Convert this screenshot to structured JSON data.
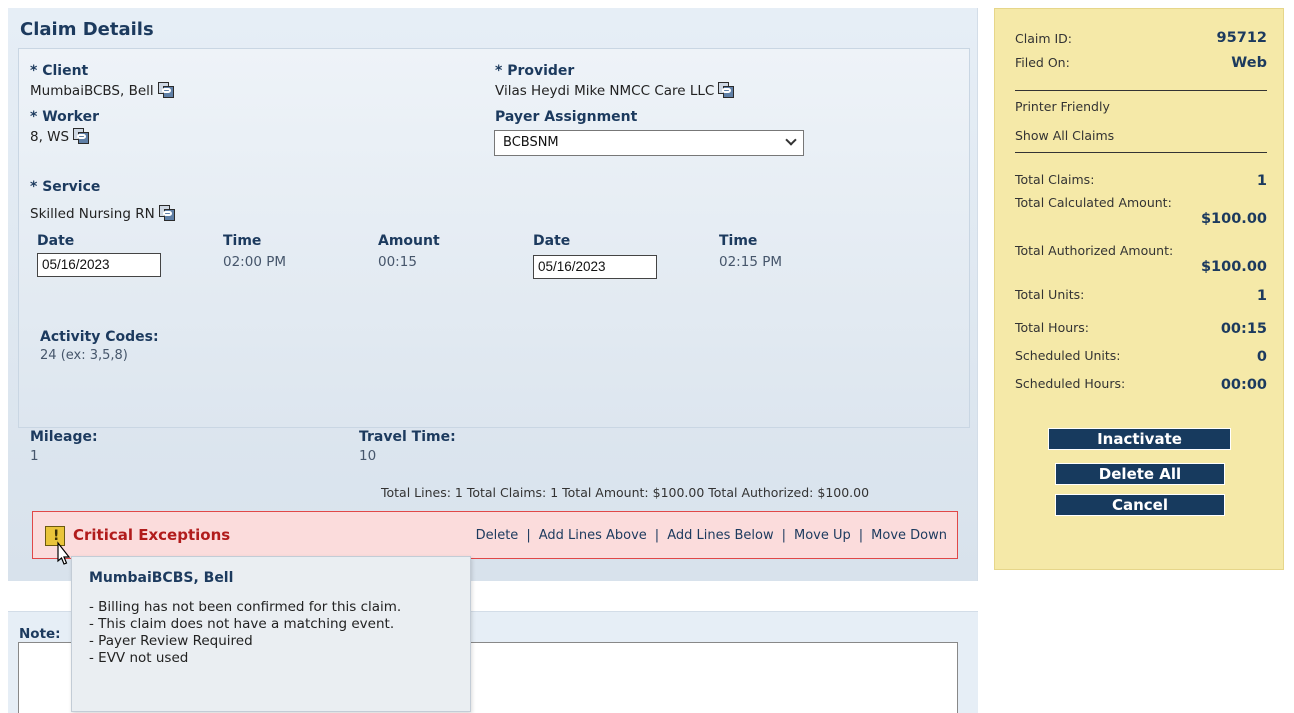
{
  "title": "Claim Details",
  "client": {
    "label": "* Client",
    "value": "MumbaiBCBS, Bell"
  },
  "provider": {
    "label": "* Provider",
    "value": "Vilas Heydi Mike NMCC Care LLC"
  },
  "worker": {
    "label": "* Worker",
    "value": "8, WS"
  },
  "payer": {
    "label": "Payer Assignment",
    "value": "BCBSNM"
  },
  "service": {
    "label": "* Service",
    "value": "Skilled Nursing RN"
  },
  "visit": {
    "start_date_label": "Date",
    "start_date": "05/16/2023",
    "start_time_label": "Time",
    "start_time": "02:00 PM",
    "amount_label": "Amount",
    "amount": "00:15",
    "end_date_label": "Date",
    "end_date": "05/16/2023",
    "end_time_label": "Time",
    "end_time": "02:15 PM"
  },
  "activity": {
    "label": "Activity Codes:",
    "value": "24",
    "hint": "(ex: 3,5,8)"
  },
  "mileage": {
    "label": "Mileage:",
    "value": "1"
  },
  "travel": {
    "label": "Travel Time:",
    "value": "10"
  },
  "totals_line": "Total Lines: 1 Total Claims: 1 Total Amount: $100.00 Total Authorized: $100.00",
  "exceptions": {
    "title": "Critical Exceptions",
    "actions": [
      "Delete",
      "Add Lines Above",
      "Add Lines Below",
      "Move Up",
      "Move Down"
    ]
  },
  "tooltip": {
    "name": "MumbaiBCBS, Bell",
    "items": [
      "- Billing has not been confirmed for this claim.",
      "- This claim does not have a matching event.",
      "- Payer Review Required",
      "- EVV not used"
    ]
  },
  "note": {
    "label": "Note:"
  },
  "side": {
    "claim_id_label": "Claim ID:",
    "claim_id": "95712",
    "filed_on_label": "Filed On:",
    "filed_on": "Web",
    "printer_friendly": "Printer Friendly",
    "show_all_claims": "Show All Claims",
    "total_claims_label": "Total Claims:",
    "total_claims": "1",
    "total_calc_label": "Total Calculated Amount:",
    "total_calc": "$100.00",
    "total_auth_label": "Total Authorized Amount:",
    "total_auth": "$100.00",
    "total_units_label": "Total Units:",
    "total_units": "1",
    "total_hours_label": "Total Hours:",
    "total_hours": "00:15",
    "sched_units_label": "Scheduled Units:",
    "sched_units": "0",
    "sched_hours_label": "Scheduled Hours:",
    "sched_hours": "00:00",
    "inactivate": "Inactivate",
    "delete_all": "Delete All",
    "cancel": "Cancel"
  },
  "colors": {
    "accent": "#173a5e",
    "exception_red": "#b11c1c",
    "side_bg": "#f5e9a8"
  }
}
